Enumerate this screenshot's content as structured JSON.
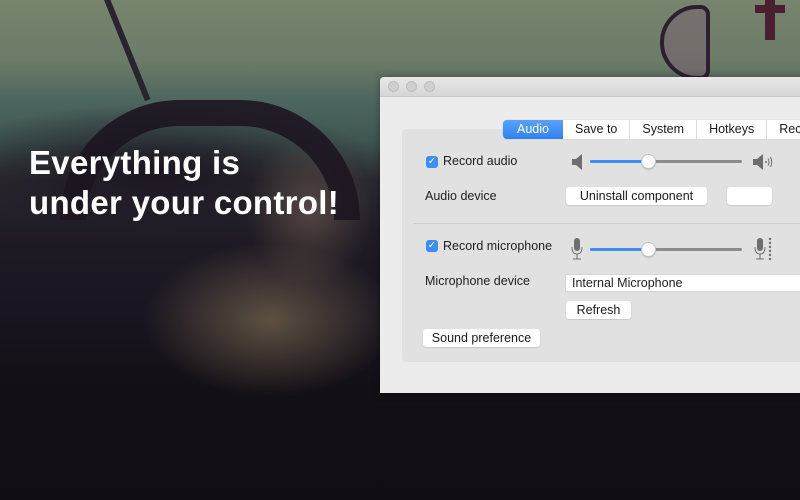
{
  "headline": {
    "line1": "Everything is",
    "line2": "under your control!"
  },
  "window": {
    "traffic_lights": [
      "close",
      "minimize",
      "zoom"
    ],
    "tabs": [
      {
        "label": "Audio",
        "active": true
      },
      {
        "label": "Save to",
        "active": false
      },
      {
        "label": "System",
        "active": false
      },
      {
        "label": "Hotkeys",
        "active": false
      },
      {
        "label": "Reco",
        "active": false
      }
    ],
    "audio": {
      "record_audio_label": "Record audio",
      "record_audio_checked": true,
      "volume_level_percent": 38,
      "left_icon": "speaker-low-icon",
      "right_icon": "speaker-high-icon",
      "device_label": "Audio device",
      "uninstall_button": "Uninstall component",
      "extra_button": ""
    },
    "microphone": {
      "record_microphone_label": "Record microphone",
      "record_microphone_checked": true,
      "volume_level_percent": 38,
      "left_icon": "microphone-icon",
      "right_icon": "microphone-loud-icon",
      "device_label": "Microphone device",
      "device_value": "Internal Microphone",
      "refresh_button": "Refresh"
    },
    "sound_preference_button": "Sound preference"
  },
  "colors": {
    "accent": "#3b8ef5",
    "window_bg": "#ececec",
    "panel_bg": "#e1e1e1"
  }
}
